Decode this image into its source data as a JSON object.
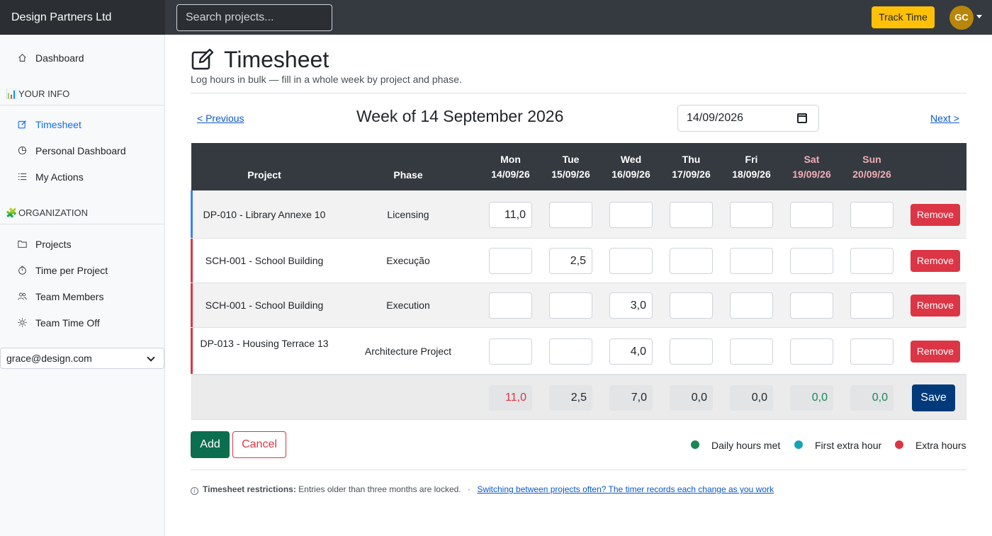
{
  "topbar": {
    "brand": "Design Partners Ltd",
    "search_placeholder": "Search projects...",
    "track_time_label": "Track Time",
    "avatar_initials": "GC"
  },
  "sidebar": {
    "dashboard": "Dashboard",
    "your_info_heading": "YOUR INFO",
    "your_info_emoji": "📊",
    "timesheet": "Timesheet",
    "personal_dashboard": "Personal Dashboard",
    "my_actions": "My Actions",
    "organization_heading": "ORGANIZATION",
    "organization_emoji": "🧩",
    "projects": "Projects",
    "time_per_project": "Time per Project",
    "team_members": "Team Members",
    "team_time_off": "Team Time Off",
    "user_select_value": "grace@design.com"
  },
  "page": {
    "title": "Timesheet",
    "subtitle": "Log hours in bulk — fill in a whole week by project and phase.",
    "prev_label": "< Previous",
    "next_label": "Next >",
    "week_title": "Week of 14 September 2026",
    "date_value": "14/09/2026"
  },
  "table": {
    "col_project": "Project",
    "col_phase": "Phase",
    "days": [
      {
        "name": "Mon",
        "date": "14/09/26",
        "weekend": false
      },
      {
        "name": "Tue",
        "date": "15/09/26",
        "weekend": false
      },
      {
        "name": "Wed",
        "date": "16/09/26",
        "weekend": false
      },
      {
        "name": "Thu",
        "date": "17/09/26",
        "weekend": false
      },
      {
        "name": "Fri",
        "date": "18/09/26",
        "weekend": false
      },
      {
        "name": "Sat",
        "date": "19/09/26",
        "weekend": true
      },
      {
        "name": "Sun",
        "date": "20/09/26",
        "weekend": true
      }
    ],
    "rows": [
      {
        "project": "DP-010 - Library Annexe 10",
        "phase": "Licensing",
        "accent": "#3b82f6",
        "hours": [
          "11,0",
          "",
          "",
          "",
          "",
          "",
          ""
        ],
        "remove": "Remove"
      },
      {
        "project": "SCH-001 - School Building",
        "phase": "Execução",
        "accent": "#dc3545",
        "hours": [
          "",
          "2,5",
          "",
          "",
          "",
          "",
          ""
        ],
        "remove": "Remove"
      },
      {
        "project": "SCH-001 - School Building",
        "phase": "Execution",
        "accent": "#dc3545",
        "hours": [
          "",
          "",
          "3,0",
          "",
          "",
          "",
          ""
        ],
        "remove": "Remove"
      },
      {
        "project": "DP-013 - Housing Terrace 13",
        "phase": "Architecture Project",
        "accent": "#dc3545",
        "hours": [
          "",
          "",
          "4,0",
          "",
          "",
          "",
          ""
        ],
        "remove": "Remove"
      }
    ],
    "totals": [
      {
        "value": "11,0",
        "status": "extra"
      },
      {
        "value": "2,5",
        "status": "normal"
      },
      {
        "value": "7,0",
        "status": "normal"
      },
      {
        "value": "0,0",
        "status": "normal"
      },
      {
        "value": "0,0",
        "status": "normal"
      },
      {
        "value": "0,0",
        "status": "weekend"
      },
      {
        "value": "0,0",
        "status": "weekend"
      }
    ],
    "save_label": "Save"
  },
  "actions": {
    "add_label": "Add",
    "cancel_label": "Cancel"
  },
  "legend": [
    {
      "label": "Daily hours met",
      "color": "#198754"
    },
    {
      "label": "First extra hour",
      "color": "#17a2b8"
    },
    {
      "label": "Extra hours",
      "color": "#dc3545"
    }
  ],
  "note": {
    "bold": "Timesheet restrictions:",
    "text": "Entries older than three months are locked.",
    "separator": "·",
    "link": "Switching between projects often? The timer records each change as you work"
  },
  "colors": {
    "topbar": "#343a40",
    "accent_blue": "#0d6efd",
    "track_time": "#ffc107",
    "remove": "#dc3545",
    "save": "#003a7a",
    "add": "#0b6e4f"
  }
}
